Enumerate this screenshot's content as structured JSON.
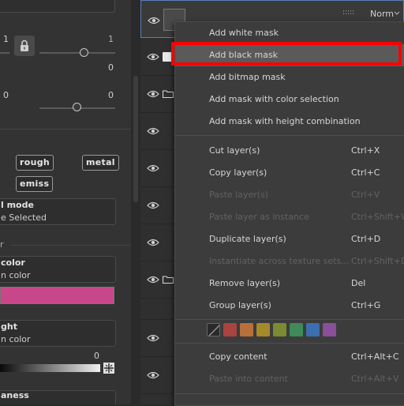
{
  "left_panel": {
    "slider1": {
      "left_value": "1",
      "right_value": "1",
      "value": "0"
    },
    "slider2": {
      "left_value": "0",
      "right_value": "0"
    },
    "channels": {
      "rough": "rough",
      "metal": "metal",
      "emiss": "emiss"
    },
    "mode": {
      "title": "l mode",
      "value": "e Selected"
    },
    "section_r": "r",
    "color": {
      "title": "color",
      "sub": "n color",
      "swatch": "#c8478a"
    },
    "height": {
      "title": "ght",
      "sub": "n color",
      "value": "0"
    },
    "roughness": {
      "title": "aness"
    }
  },
  "layers": {
    "top_layer": {
      "blend_mode": "Norm",
      "dots": ":::::"
    }
  },
  "context_menu": {
    "items": [
      {
        "label": "Add white mask",
        "shortcut": "",
        "disabled": false
      },
      {
        "label": "Add black mask",
        "shortcut": "",
        "disabled": false
      },
      {
        "label": "Add bitmap mask",
        "shortcut": "",
        "disabled": false
      },
      {
        "label": "Add mask with color selection",
        "shortcut": "",
        "disabled": false
      },
      {
        "label": "Add mask with height combination",
        "shortcut": "",
        "disabled": false
      },
      {
        "label": "Cut layer(s)",
        "shortcut": "Ctrl+X",
        "disabled": false
      },
      {
        "label": "Copy layer(s)",
        "shortcut": "Ctrl+C",
        "disabled": false
      },
      {
        "label": "Paste layer(s)",
        "shortcut": "Ctrl+V",
        "disabled": true
      },
      {
        "label": "Paste layer as instance",
        "shortcut": "Ctrl+Shift+V",
        "disabled": true
      },
      {
        "label": "Duplicate layer(s)",
        "shortcut": "Ctrl+D",
        "disabled": false
      },
      {
        "label": "Instantiate across texture sets...",
        "shortcut": "Ctrl+Shift+D",
        "disabled": true
      },
      {
        "label": "Remove layer(s)",
        "shortcut": "Del",
        "disabled": false
      },
      {
        "label": "Group layer(s)",
        "shortcut": "Ctrl+G",
        "disabled": false
      },
      {
        "label": "Copy content",
        "shortcut": "Ctrl+Alt+C",
        "disabled": false
      },
      {
        "label": "Paste into content",
        "shortcut": "Ctrl+Alt+V",
        "disabled": true
      }
    ],
    "highlighted": "Add black mask",
    "color_tags": [
      "none",
      "#a94440",
      "#b8703a",
      "#a68a2a",
      "#7c8a32",
      "#3f8a58",
      "#3b6fb0",
      "#8a4f9a"
    ]
  }
}
